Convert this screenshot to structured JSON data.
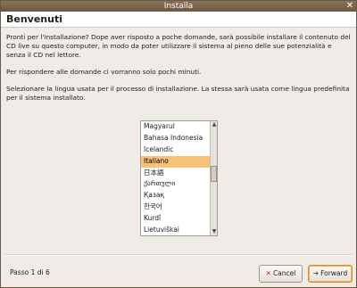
{
  "window": {
    "title": "Installa"
  },
  "heading": "Benvenuti",
  "intro": {
    "p1": "Pronti per l'installazione? Dope aver risposto a poche domande, sarà possibile installare il contenuto del CD live su questo computer, in modo da poter utilizzare il sistema al pieno delle sue potenzialità e senza il CD nel lettore.",
    "p2": "Per rispondere alle domande ci vorranno solo pochi minuti.",
    "p3": "Selezionare la lingua usata per il processo di installazione. La stessa sarà usata come lingua predefinita per il sistema installato."
  },
  "languages": [
    "Magyarul",
    "Bahasa Indonesia",
    "Icelandic",
    "Italiano",
    "日本語",
    "ქართული",
    "Қазақ",
    "한국어",
    "Kurdî",
    "Lietuviškai"
  ],
  "selected_language": "Italiano",
  "footer": {
    "step": "Passo 1 di 6",
    "cancel_label": "Cancel",
    "forward_label": "Forward"
  },
  "colors": {
    "selection": "#f7c177",
    "titlebar": "#7a644b"
  }
}
